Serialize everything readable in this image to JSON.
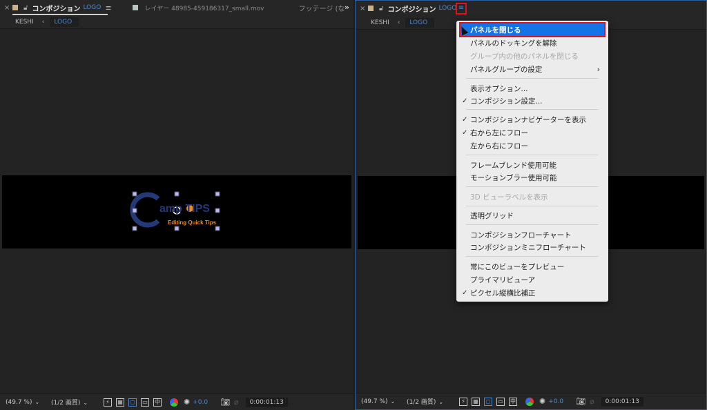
{
  "left_panel": {
    "close_glyph": "×",
    "comp_title": "コンポジション",
    "comp_name": "LOGO",
    "menu_glyph": "≡",
    "layer_tab": "レイヤー 48985-459186317_small.mov",
    "footage_tab": "フッテージ (な",
    "overflow_glyph": "»",
    "breadcrumb_root": "KESHI",
    "breadcrumb_arrow": "‹",
    "breadcrumb_current": "LOGO",
    "logo_title": "amp TIPS",
    "logo_sub": "Editing Quick Tips",
    "zoom": "(49.7 %)",
    "resolution": "(1/2 画質)",
    "exposure": "+0.0",
    "timecode": "0:00:01:13"
  },
  "right_panel": {
    "close_glyph": "×",
    "comp_title": "コンポジション",
    "comp_name": "LOGO",
    "menu_glyph": "≡",
    "breadcrumb_root": "KESHI",
    "breadcrumb_arrow": "‹",
    "breadcrumb_current": "LOGO",
    "zoom": "(49.7 %)",
    "resolution": "(1/2 画質)",
    "exposure": "+0.0",
    "timecode": "0:00:01:13"
  },
  "context_menu": {
    "items": [
      {
        "label": "パネルを閉じる",
        "checked": false,
        "disabled": false,
        "highlight": true
      },
      {
        "label": "パネルのドッキングを解除",
        "checked": false,
        "disabled": false
      },
      {
        "label": "グループ内の他のパネルを閉じる",
        "checked": false,
        "disabled": true
      },
      {
        "label": "パネルグループの設定",
        "checked": false,
        "disabled": false,
        "submenu": true
      },
      {
        "label": "表示オプション...",
        "checked": false,
        "disabled": false
      },
      {
        "label": "コンポジション設定...",
        "checked": true,
        "disabled": false
      },
      {
        "label": "コンポジションナビゲーターを表示",
        "checked": true,
        "disabled": false
      },
      {
        "label": "右から左にフロー",
        "checked": true,
        "disabled": false
      },
      {
        "label": "左から右にフロー",
        "checked": false,
        "disabled": false
      },
      {
        "label": "フレームブレンド使用可能",
        "checked": false,
        "disabled": false
      },
      {
        "label": "モーションブラー使用可能",
        "checked": false,
        "disabled": false
      },
      {
        "label": "3D ビューラベルを表示",
        "checked": false,
        "disabled": true
      },
      {
        "label": "透明グリッド",
        "checked": false,
        "disabled": false
      },
      {
        "label": "コンポジションフローチャート",
        "checked": false,
        "disabled": false
      },
      {
        "label": "コンポジションミニフローチャート",
        "checked": false,
        "disabled": false
      },
      {
        "label": "常にこのビューをプレビュー",
        "checked": false,
        "disabled": false
      },
      {
        "label": "プライマリビューア",
        "checked": false,
        "disabled": false
      },
      {
        "label": "ピクセル縦横比補正",
        "checked": true,
        "disabled": false
      }
    ],
    "check_glyph": "✓",
    "submenu_glyph": "›"
  },
  "colors": {
    "accent": "#1473e6",
    "highlight_border": "#e0121a",
    "link_blue": "#4b8ad6",
    "logo_orange": "#f08a1c",
    "logo_navy": "#243a78"
  }
}
